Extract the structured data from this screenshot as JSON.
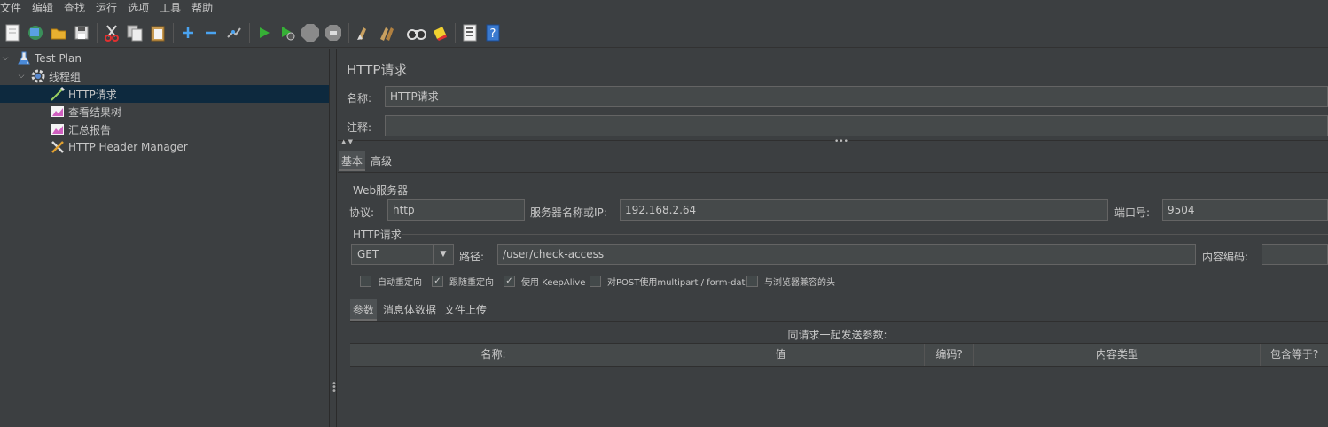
{
  "menu": [
    "文件",
    "编辑",
    "查找",
    "运行",
    "选项",
    "工具",
    "帮助"
  ],
  "toolbar": {
    "icons": [
      "new-icon",
      "templates-icon",
      "open-icon",
      "save-icon",
      "cut-icon",
      "copy-icon",
      "paste-icon",
      "expand-icon",
      "collapse-icon",
      "toggle-icon",
      "start-icon",
      "start-no-pause-icon",
      "stop-icon",
      "shutdown-icon",
      "clear-icon",
      "clear-all-icon",
      "search-icon",
      "reset-search-icon",
      "function-helper-icon",
      "help-icon"
    ]
  },
  "tree": [
    {
      "label": "Test Plan",
      "icon": "test-plan-icon",
      "expanded": true
    },
    {
      "label": "线程组",
      "icon": "gear-icon",
      "expanded": true
    },
    {
      "label": "HTTP请求",
      "icon": "pipette-icon",
      "selected": true
    },
    {
      "label": "查看结果树",
      "icon": "graph-icon"
    },
    {
      "label": "汇总报告",
      "icon": "graph-icon"
    },
    {
      "label": "HTTP Header Manager",
      "icon": "wrench-icon"
    }
  ],
  "panel": {
    "title": "HTTP请求",
    "name_label": "名称:",
    "name_value": "HTTP请求",
    "comment_label": "注释:",
    "comment_value": "",
    "tabs": [
      "基本",
      "高级"
    ],
    "web_server": {
      "group_label": "Web服务器",
      "protocol_label": "协议:",
      "protocol_value": "http",
      "server_label": "服务器名称或IP:",
      "server_value": "192.168.2.64",
      "port_label": "端口号:",
      "port_value": "9504"
    },
    "http_request": {
      "group_label": "HTTP请求",
      "method": "GET",
      "path_label": "路径:",
      "path_value": "/user/check-access",
      "encoding_label": "内容编码:",
      "encoding_value": ""
    },
    "checkboxes": [
      {
        "label": "自动重定向",
        "checked": false
      },
      {
        "label": "跟随重定向",
        "checked": true
      },
      {
        "label": "使用 KeepAlive",
        "checked": true
      },
      {
        "label": "对POST使用multipart / form-data",
        "checked": false
      },
      {
        "label": "与浏览器兼容的头",
        "checked": false
      }
    ],
    "sub_tabs": [
      "参数",
      "消息体数据",
      "文件上传"
    ],
    "params_caption": "同请求一起发送参数:",
    "columns": [
      "名称:",
      "值",
      "编码?",
      "内容类型",
      "包含等于?"
    ]
  }
}
